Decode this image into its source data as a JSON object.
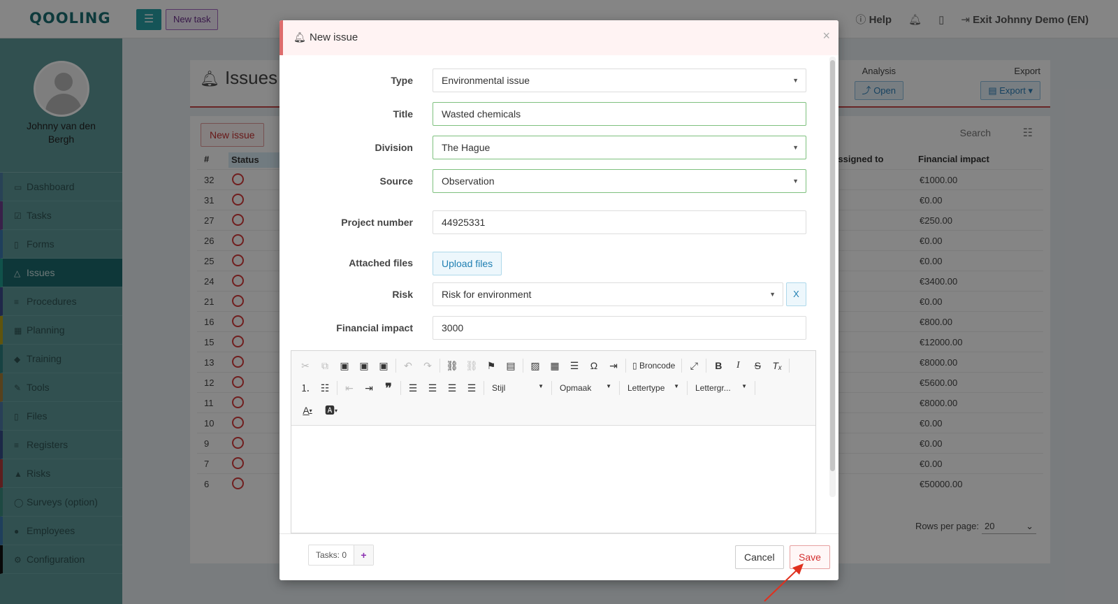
{
  "app": {
    "logo": "QOOLING",
    "new_task_label": "New task",
    "help_label": "Help",
    "exit_label": "Exit Johnny Demo (EN)"
  },
  "profile": {
    "name": "Johnny van den Bergh"
  },
  "nav": {
    "items": [
      {
        "label": "Dashboard",
        "icon": "monitor-icon"
      },
      {
        "label": "Tasks",
        "icon": "check-square-icon"
      },
      {
        "label": "Forms",
        "icon": "file-icon"
      },
      {
        "label": "Issues",
        "icon": "bell-icon"
      },
      {
        "label": "Procedures",
        "icon": "list-icon"
      },
      {
        "label": "Planning",
        "icon": "calendar-icon"
      },
      {
        "label": "Training",
        "icon": "graduation-icon"
      },
      {
        "label": "Tools",
        "icon": "wrench-icon"
      },
      {
        "label": "Files",
        "icon": "file-icon"
      },
      {
        "label": "Registers",
        "icon": "list-icon"
      },
      {
        "label": "Risks",
        "icon": "warning-icon"
      },
      {
        "label": "Surveys (option)",
        "icon": "comment-icon"
      },
      {
        "label": "Employees",
        "icon": "users-icon"
      },
      {
        "label": "Configuration",
        "icon": "gear-icon"
      }
    ]
  },
  "issues_page": {
    "title": "Issues",
    "analysis_label": "Analysis",
    "open_label": "Open",
    "export_header": "Export",
    "export_label": "Export",
    "new_issue_label": "New issue",
    "search_placeholder": "Search",
    "columns": [
      "#",
      "Status",
      "Assigned to",
      "Financial impact"
    ],
    "rows": [
      {
        "num": "32",
        "fin": "€1000.00"
      },
      {
        "num": "31",
        "fin": "€0.00"
      },
      {
        "num": "27",
        "fin": "€250.00"
      },
      {
        "num": "26",
        "fin": "€0.00"
      },
      {
        "num": "25",
        "fin": "€0.00"
      },
      {
        "num": "24",
        "fin": "€3400.00"
      },
      {
        "num": "21",
        "fin": "€0.00"
      },
      {
        "num": "16",
        "fin": "€800.00"
      },
      {
        "num": "15",
        "fin": "€12000.00"
      },
      {
        "num": "13",
        "fin": "€8000.00"
      },
      {
        "num": "12",
        "fin": "€5600.00"
      },
      {
        "num": "11",
        "fin": "€8000.00"
      },
      {
        "num": "10",
        "fin": "€0.00"
      },
      {
        "num": "9",
        "fin": "€0.00"
      },
      {
        "num": "7",
        "fin": "€0.00"
      },
      {
        "num": "6",
        "fin": "€50000.00"
      }
    ],
    "rows_per_page_label": "Rows per page:",
    "rows_per_page_value": "20"
  },
  "modal": {
    "title": "New issue",
    "close": "×",
    "type_label": "Type",
    "type_value": "Environmental issue",
    "title_label": "Title",
    "title_value": "Wasted chemicals",
    "division_label": "Division",
    "division_value": "The Hague",
    "source_label": "Source",
    "source_value": "Observation",
    "project_label": "Project number",
    "project_value": "44925331",
    "files_label": "Attached files",
    "upload_label": "Upload files",
    "risk_label": "Risk",
    "risk_value": "Risk for environment",
    "risk_clear": "X",
    "financial_label": "Financial impact",
    "financial_value": "3000",
    "editor": {
      "broncode_label": "Broncode",
      "stijl_label": "Stijl",
      "opmaak_label": "Opmaak",
      "lettertype_label": "Lettertype",
      "lettergrootte_label": "Lettergr..."
    },
    "tasks_label": "Tasks: 0",
    "cancel_label": "Cancel",
    "save_label": "Save"
  }
}
